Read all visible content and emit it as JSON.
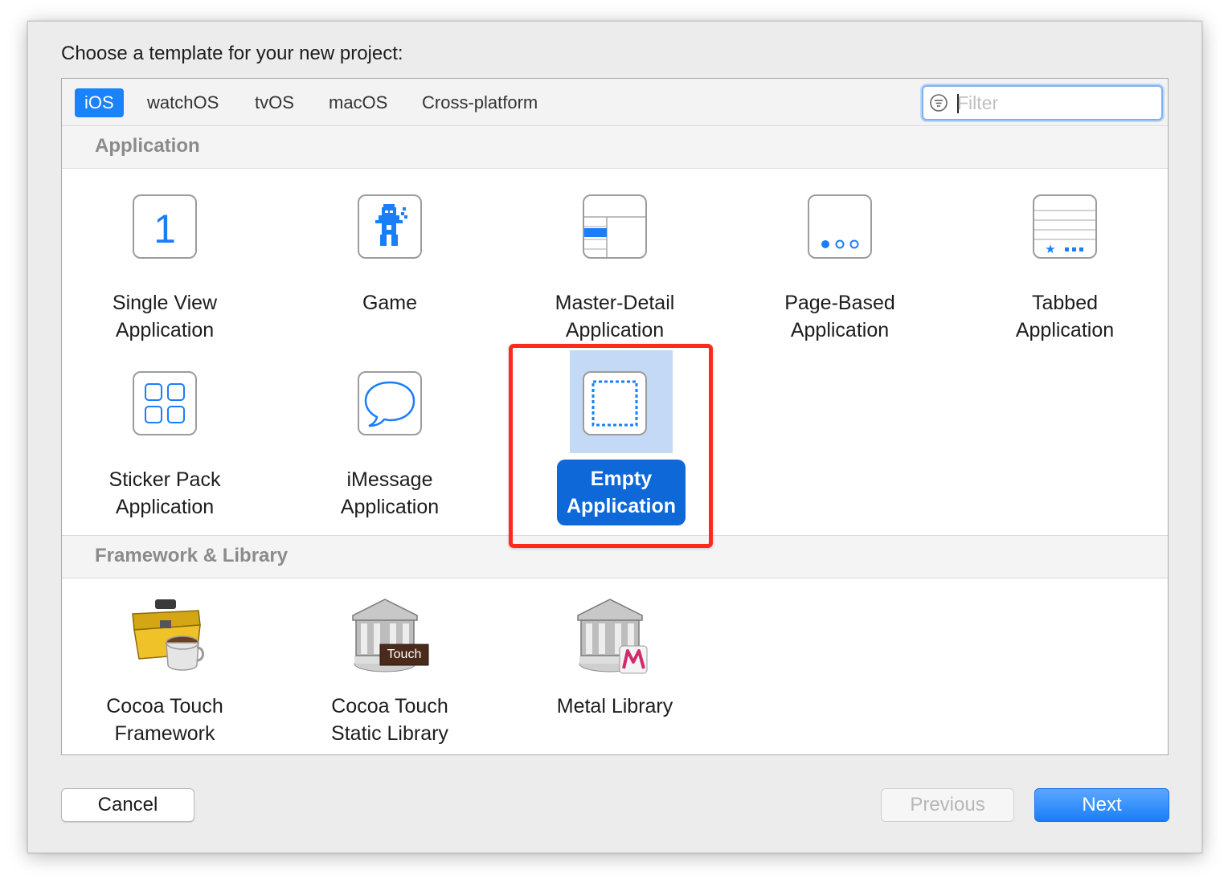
{
  "dialog": {
    "prompt": "Choose a template for your new project:"
  },
  "tabs": [
    {
      "label": "iOS",
      "selected": true
    },
    {
      "label": "watchOS",
      "selected": false
    },
    {
      "label": "tvOS",
      "selected": false
    },
    {
      "label": "macOS",
      "selected": false
    },
    {
      "label": "Cross-platform",
      "selected": false
    }
  ],
  "filter": {
    "placeholder": "Filter",
    "value": ""
  },
  "sections": [
    {
      "title": "Application",
      "templates": [
        {
          "label": "Single View\nApplication",
          "icon": "single-view-icon"
        },
        {
          "label": "Game",
          "icon": "game-icon"
        },
        {
          "label": "Master-Detail\nApplication",
          "icon": "master-detail-icon"
        },
        {
          "label": "Page-Based\nApplication",
          "icon": "page-based-icon"
        },
        {
          "label": "Tabbed\nApplication",
          "icon": "tabbed-icon"
        },
        {
          "label": "Sticker Pack\nApplication",
          "icon": "sticker-pack-icon"
        },
        {
          "label": "iMessage\nApplication",
          "icon": "imessage-icon"
        },
        {
          "label": "Empty\nApplication",
          "icon": "empty-application-icon",
          "selected": true
        }
      ]
    },
    {
      "title": "Framework & Library",
      "templates": [
        {
          "label": "Cocoa Touch\nFramework",
          "icon": "toolbox-icon"
        },
        {
          "label": "Cocoa Touch\nStatic Library",
          "icon": "library-icon",
          "badge": "Touch"
        },
        {
          "label": "Metal Library",
          "icon": "metal-library-icon"
        }
      ]
    }
  ],
  "buttons": {
    "cancel": "Cancel",
    "previous": "Previous",
    "next": "Next"
  },
  "colors": {
    "accent": "#1a82fb",
    "selection": "#0e68d8",
    "highlight_box": "#ff2a1a"
  }
}
